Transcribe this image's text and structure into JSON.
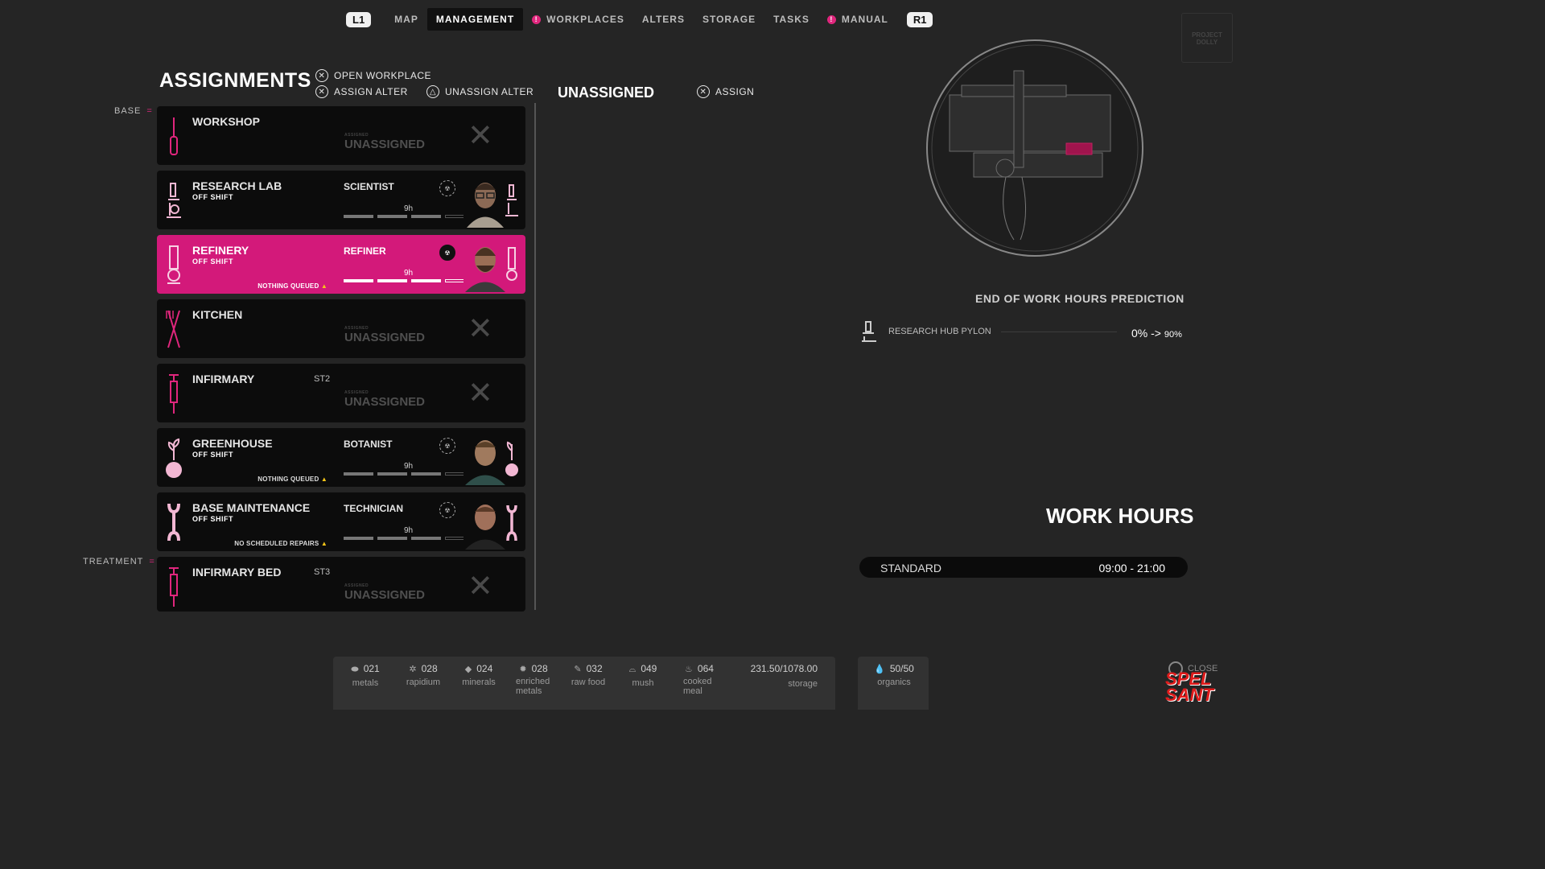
{
  "nav": {
    "left_button": "L1",
    "right_button": "R1",
    "items": [
      {
        "label": "MAP",
        "alert": false,
        "active": false
      },
      {
        "label": "MANAGEMENT",
        "alert": false,
        "active": true
      },
      {
        "label": "WORKPLACES",
        "alert": true,
        "active": false
      },
      {
        "label": "ALTERS",
        "alert": false,
        "active": false
      },
      {
        "label": "STORAGE",
        "alert": false,
        "active": false
      },
      {
        "label": "TASKS",
        "alert": false,
        "active": false
      },
      {
        "label": "MANUAL",
        "alert": true,
        "active": false
      }
    ]
  },
  "header": {
    "title": "ASSIGNMENTS",
    "hints": [
      "OPEN WORKPLACE",
      "ASSIGN ALTER",
      "UNASSIGN ALTER"
    ],
    "unassigned_title": "UNASSIGNED",
    "assign_hint": "ASSIGN"
  },
  "sections": {
    "base": "BASE",
    "treatment": "TREATMENT"
  },
  "cards": [
    {
      "name": "WORKSHOP",
      "shift": "",
      "tag": "",
      "assigned_label": "ASSIGNED",
      "unassigned": "UNASSIGNED",
      "role": "",
      "hours": "",
      "status": "",
      "icon": "screwdriver-icon"
    },
    {
      "name": "RESEARCH LAB",
      "shift": "OFF SHIFT",
      "tag": "",
      "role": "SCIENTIST",
      "hours": "9h",
      "status": "",
      "icon": "microscope-icon"
    },
    {
      "name": "REFINERY",
      "shift": "OFF SHIFT",
      "tag": "",
      "role": "REFINER",
      "hours": "9h",
      "status": "NOTHING QUEUED",
      "icon": "refinery-icon"
    },
    {
      "name": "KITCHEN",
      "shift": "",
      "tag": "",
      "assigned_label": "ASSIGNED",
      "unassigned": "UNASSIGNED",
      "icon": "utensils-icon"
    },
    {
      "name": "INFIRMARY",
      "shift": "",
      "tag": "ST2",
      "assigned_label": "ASSIGNED",
      "unassigned": "UNASSIGNED",
      "icon": "syringe-icon"
    },
    {
      "name": "GREENHOUSE",
      "shift": "OFF SHIFT",
      "tag": "",
      "role": "BOTANIST",
      "hours": "9h",
      "status": "NOTHING QUEUED",
      "icon": "plant-icon"
    },
    {
      "name": "BASE MAINTENANCE",
      "shift": "OFF SHIFT",
      "tag": "",
      "role": "TECHNICIAN",
      "hours": "9h",
      "status": "NO SCHEDULED REPAIRS",
      "icon": "wrench-icon"
    },
    {
      "name": "INFIRMARY BED",
      "shift": "",
      "tag": "ST3",
      "assigned_label": "ASSIGNED",
      "unassigned": "UNASSIGNED",
      "icon": "syringe-icon"
    }
  ],
  "prediction": {
    "title": "END OF WORK HOURS PREDICTION",
    "item_label": "RESEARCH HUB PYLON",
    "from": "0%",
    "arrow": "->",
    "to": "90%"
  },
  "work_hours": {
    "title": "WORK HOURS",
    "schedule_name": "STANDARD",
    "schedule_time": "09:00 - 21:00"
  },
  "resources": [
    {
      "value": "021",
      "label": "metals"
    },
    {
      "value": "028",
      "label": "rapidium"
    },
    {
      "value": "024",
      "label": "minerals"
    },
    {
      "value": "028",
      "label": "enriched metals"
    },
    {
      "value": "032",
      "label": "raw food"
    },
    {
      "value": "049",
      "label": "mush"
    },
    {
      "value": "064",
      "label": "cooked meal"
    }
  ],
  "storage": {
    "value": "231.50/1078.00",
    "label": "storage"
  },
  "organics": {
    "value": "50/50",
    "label": "organics"
  },
  "close_label": "CLOSE",
  "logo_text": "PROJECT DOLLY",
  "watermark": "SPEL SANT",
  "colors": {
    "accent": "#d3197a",
    "background": "#252525",
    "card": "#0c0c0c"
  }
}
